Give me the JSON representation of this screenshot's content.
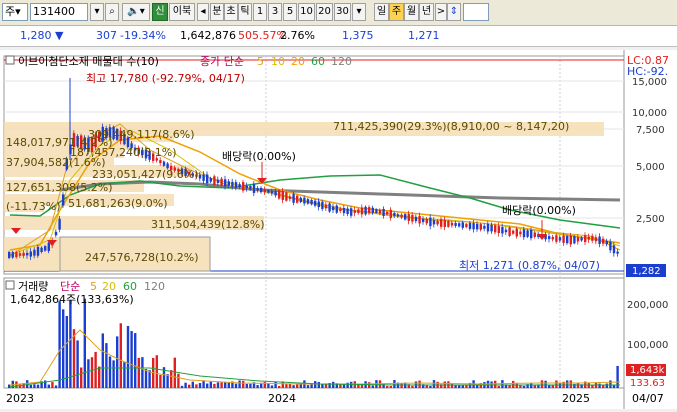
{
  "toolbar": {
    "market": "주",
    "code": "131400",
    "tab_new": "신",
    "tab_ibuk": "이북",
    "nav_left": "◂",
    "tab_minute": "분",
    "tab_tick": "초",
    "tab_tick2": "틱",
    "periods": [
      "1",
      "3",
      "5",
      "10",
      "20",
      "30"
    ],
    "period_dropdown": "▾",
    "tab_day": "일",
    "tab_week": "주",
    "tab_month": "월",
    "tab_year": "년",
    "nav_right": ">",
    "updown": "⇕"
  },
  "info": {
    "price": "1,280",
    "change_arrow": "▼",
    "change": "307",
    "change_pct": "-19.34%",
    "volume": "1,642,876",
    "vol_ratio": "505.57%",
    "turnover": "2.76%",
    "high": "1,375",
    "low": "1,271"
  },
  "price_panel": {
    "name_label": "이브이첨단소재 매물대 수(10)",
    "ma_label": "종가 단순",
    "ma_periods": [
      "5",
      "10",
      "20",
      "60",
      "120"
    ],
    "lc_label": "LC:0.87",
    "hc_label": "HC:-92.",
    "high_note": "최고 17,780 (-92.79%, 04/17)",
    "low_note": "최저 1,271 (0.87%, 04/07)",
    "dividend1": "배당락(0.00%)",
    "dividend2": "배당락(0.00%)",
    "current_price": "1,282",
    "y_ticks": [
      "15,000",
      "10,000",
      "7,500",
      "5,000",
      "2,500"
    ],
    "volume_profile": [
      "711,425,390(29.3%)(8,910,00 ~ 8,147,20)",
      "309,449,117(8.6%)",
      "148,017,971(4.2%)",
      "187,457,240(5.1%)",
      "37,904,582(1.6%)",
      "233,051,427(9.6%)",
      "127,651,308(5.2%)",
      "51,681,263(9.0%)",
      "(-11.73%)",
      "311,504,439(12.8%)",
      "247,576,728(10.2%)"
    ]
  },
  "volume_panel": {
    "label": "거래량",
    "ma_label": "단순",
    "ma_periods": [
      "5",
      "20",
      "60",
      "120"
    ],
    "current_value": "1,642,864주(133,63%)",
    "y_ticks": [
      "200,000",
      "100,000"
    ],
    "right_value": "1,643k",
    "right_pct": "133.63"
  },
  "x_axis": [
    "2023",
    "2024",
    "2025",
    "04/07"
  ],
  "colors": {
    "up": "#e02020",
    "down": "#1a3fd0",
    "ma5": "#e0a020",
    "ma10": "#d4c000",
    "ma20": "#f0a000",
    "ma60": "#20a040",
    "ma120": "#808080"
  }
}
